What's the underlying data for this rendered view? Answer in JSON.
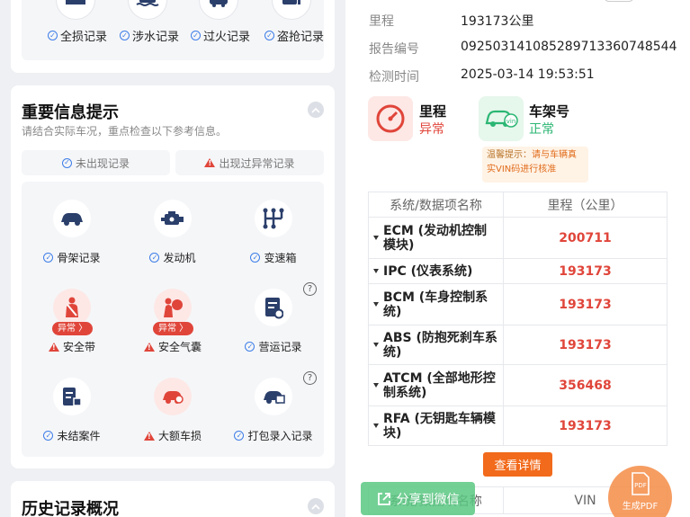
{
  "top_card": {
    "items": [
      {
        "label": "全损记录",
        "icon": "car-crushed-icon"
      },
      {
        "label": "涉水记录",
        "icon": "car-water-icon"
      },
      {
        "label": "过火记录",
        "icon": "car-fire-icon"
      },
      {
        "label": "盗抢记录",
        "icon": "car-theft-icon"
      }
    ]
  },
  "important": {
    "title": "重要信息提示",
    "subtitle": "请结合实际车况，重点检查以下参考信息。",
    "legend_normal": "未出现记录",
    "legend_abnormal": "出现过异常记录",
    "badge_text": "异常 〉",
    "items": [
      {
        "label": "骨架记录",
        "status": "ok"
      },
      {
        "label": "发动机",
        "status": "ok"
      },
      {
        "label": "变速箱",
        "status": "ok"
      },
      {
        "label": "安全带",
        "status": "abnormal"
      },
      {
        "label": "安全气囊",
        "status": "abnormal"
      },
      {
        "label": "营运记录",
        "status": "ok"
      },
      {
        "label": "未结案件",
        "status": "ok"
      },
      {
        "label": "大额车损",
        "status": "abnormal"
      },
      {
        "label": "打包录入记录",
        "status": "ok"
      }
    ],
    "help_glyph": "?"
  },
  "history": {
    "title": "历史记录概况"
  },
  "report_info": {
    "rows": [
      {
        "label": "里程",
        "value": "193173公里"
      },
      {
        "label": "报告编号",
        "value": "092503141085289713360748544"
      },
      {
        "label": "检测时间",
        "value": "2025-03-14 19:53:51"
      }
    ]
  },
  "status": {
    "mileage_name": "里程",
    "mileage_value": "异常",
    "vin_name": "车架号",
    "vin_value": "正常",
    "vin_icon_text": "vin",
    "tip_prefix": "温馨提示：",
    "tip_text": "请与车辆真实VIN码进行核准"
  },
  "mileage_table": {
    "headers": [
      "系统/数据项名称",
      "里程（公里）"
    ],
    "rows": [
      {
        "name": "ECM (发动机控制模块)",
        "value": "200711"
      },
      {
        "name": "IPC (仪表系统)",
        "value": "193173"
      },
      {
        "name": "BCM (车身控制系统)",
        "value": "193173"
      },
      {
        "name": "ABS (防抱死刹车系统)",
        "value": "193173"
      },
      {
        "name": "ATCM (全部地形控制系统)",
        "value": "356468"
      },
      {
        "name": "RFA (无钥匙车辆模块)",
        "value": "193173"
      }
    ]
  },
  "detail_button": "查看详情",
  "vin_table": {
    "headers": [
      "系统/数据项名称",
      "VIN"
    ]
  },
  "share_button": "分享到微信",
  "pdf_button": "生成PDF",
  "pdf_icon_text": "PDF",
  "colors": {
    "accent_blue": "#3d7de8",
    "abnormal_red": "#e0453a",
    "orange": "#f26a1b",
    "green": "#2bb673"
  }
}
